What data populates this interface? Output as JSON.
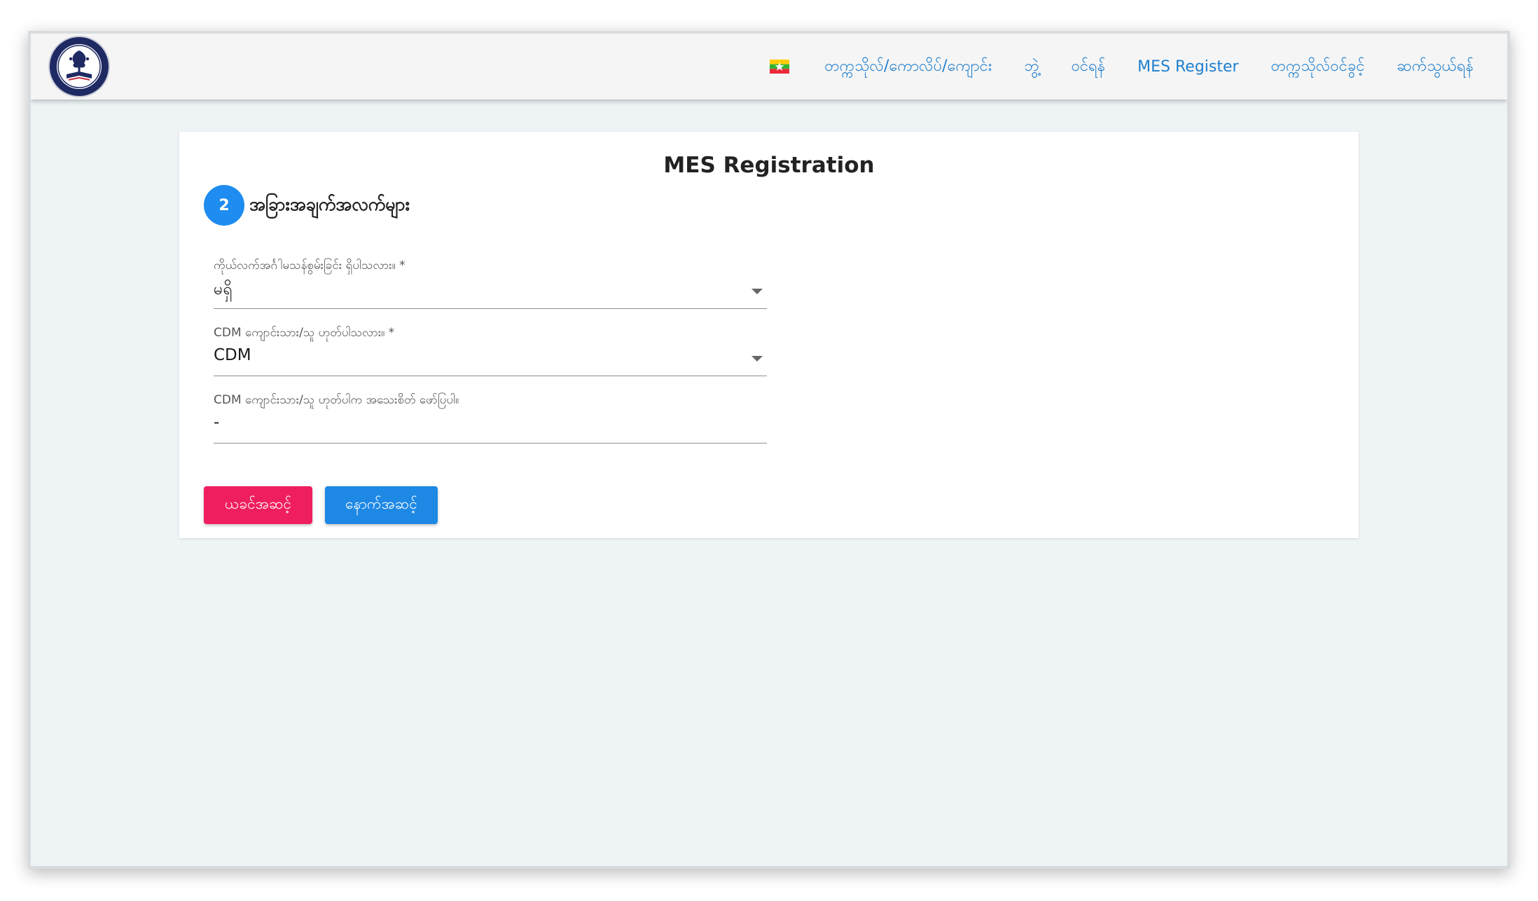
{
  "nav": {
    "items": [
      {
        "label": "တက္ကသိုလ်/ကောလိပ်/ကျောင်း"
      },
      {
        "label": "ဘွဲ့"
      },
      {
        "label": "ဝင်ရန်"
      },
      {
        "label": "MES Register"
      },
      {
        "label": "တက္ကသိုလ်ဝင်ခွင့်"
      },
      {
        "label": "ဆက်သွယ်ရန်"
      }
    ]
  },
  "colors": {
    "nav_link": "#1e7fcf",
    "step_badge": "#1e8cf0",
    "back_button": "#ef1f5f",
    "next_button": "#1e88e5"
  },
  "form": {
    "title": "MES Registration",
    "step_number": "2",
    "step_title": "အခြားအချက်အလက်များ",
    "fields": [
      {
        "label": "ကိုယ်လက်အင်္ဂါမသန်စွမ်းခြင်း ရှိပါသလား။ *",
        "value": "မရှိ",
        "type": "select"
      },
      {
        "label": "CDM ကျောင်းသား/သူ ဟုတ်ပါသလား။ *",
        "value": "CDM",
        "type": "select"
      },
      {
        "label": "CDM ကျောင်းသား/သူ ဟုတ်ပါက အသေးစိတ် ဖော်ပြပါ။",
        "value": "-",
        "type": "text"
      }
    ],
    "back_label": "ယခင်အဆင့်",
    "next_label": "နောက်အဆင့်"
  }
}
